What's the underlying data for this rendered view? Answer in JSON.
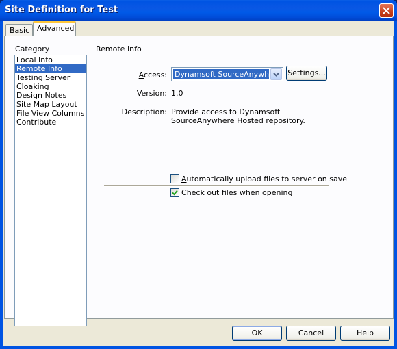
{
  "window": {
    "title": "Site Definition for Test"
  },
  "tabs": [
    {
      "label": "Basic",
      "selected": false
    },
    {
      "label": "Advanced",
      "selected": true
    }
  ],
  "category": {
    "label": "Category",
    "items": [
      {
        "label": "Local Info",
        "selected": false
      },
      {
        "label": "Remote Info",
        "selected": true
      },
      {
        "label": "Testing Server",
        "selected": false
      },
      {
        "label": "Cloaking",
        "selected": false
      },
      {
        "label": "Design Notes",
        "selected": false
      },
      {
        "label": "Site Map Layout",
        "selected": false
      },
      {
        "label": "File View Columns",
        "selected": false
      },
      {
        "label": "Contribute",
        "selected": false
      }
    ]
  },
  "remote": {
    "section_title": "Remote Info",
    "access_label_u": "A",
    "access_label_rest": "ccess:",
    "access_value": "Dynamsoft SourceAnywhere",
    "settings_button": "Settings...",
    "version_label": "Version:",
    "version_value": "1.0",
    "description_label": "Description:",
    "description_line1": "Provide access to Dynamsoft",
    "description_line2": "SourceAnywhere Hosted repository.",
    "auto_upload": {
      "label_u": "A",
      "label_rest": "utomatically upload files to server on save",
      "checked": false
    },
    "checkout": {
      "label_u": "C",
      "label_rest": "heck out files when opening",
      "checked": true
    }
  },
  "footer": {
    "ok": "OK",
    "cancel": "Cancel",
    "help": "Help"
  },
  "colors": {
    "titlebar": "#0054E3",
    "selection": "#316AC5",
    "dialog_bg": "#ECE9D8"
  }
}
